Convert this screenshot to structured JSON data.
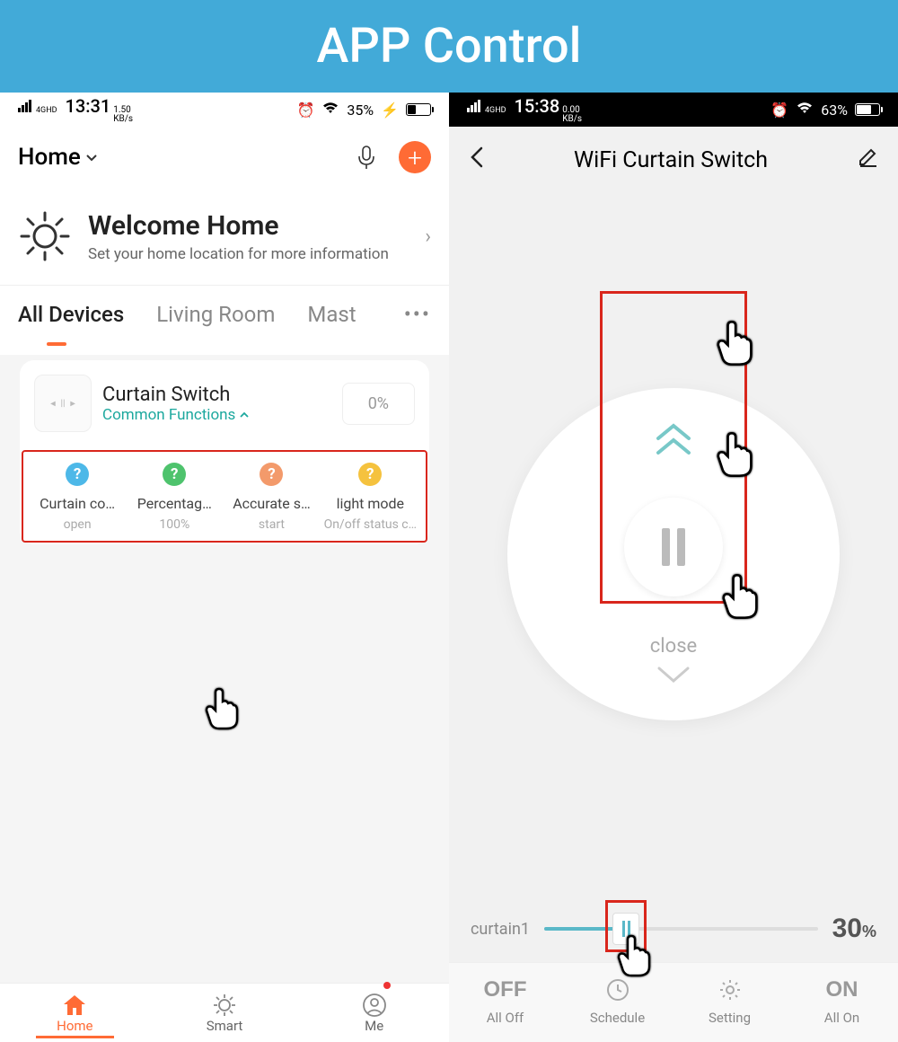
{
  "banner": {
    "title": "APP Control"
  },
  "left": {
    "statusbar": {
      "network": "4GHD",
      "time": "13:31",
      "kbps": "1.50",
      "kbps_unit": "KB/s",
      "battery_label": "35%",
      "battery_fill_pct": 35,
      "charging": true
    },
    "header": {
      "home_label": "Home"
    },
    "welcome": {
      "title": "Welcome Home",
      "subtitle": "Set your home location for more information"
    },
    "tabs": {
      "items": [
        "All Devices",
        "Living Room",
        "Mast"
      ],
      "more": "•••"
    },
    "card": {
      "device_name": "Curtain Switch",
      "common_functions": "Common Functions",
      "percent": "0%",
      "functions": [
        {
          "label": "Curtain co…",
          "value": "open",
          "color": "#4db8e8"
        },
        {
          "label": "Percentag…",
          "value": "100%",
          "color": "#4ec36d"
        },
        {
          "label": "Accurate s…",
          "value": "start",
          "color": "#f39a6b"
        },
        {
          "label": "light mode",
          "value": "On/off status c…",
          "color": "#f5c23e"
        }
      ]
    },
    "bottom_nav": {
      "home": "Home",
      "smart": "Smart",
      "me": "Me"
    }
  },
  "right": {
    "statusbar": {
      "network": "4GHD",
      "time": "15:38",
      "kbps": "0.00",
      "kbps_unit": "KB/s",
      "battery_label": "63%",
      "battery_fill_pct": 63
    },
    "header": {
      "title": "WiFi Curtain Switch"
    },
    "control": {
      "close_label": "close"
    },
    "slider": {
      "label": "curtain1",
      "percent_value": "30",
      "percent_sym": "%",
      "fill_pct": 30
    },
    "bottom": {
      "off": "OFF",
      "all_off": "All Off",
      "schedule": "Schedule",
      "setting": "Setting",
      "on": "ON",
      "all_on": "All On"
    }
  }
}
